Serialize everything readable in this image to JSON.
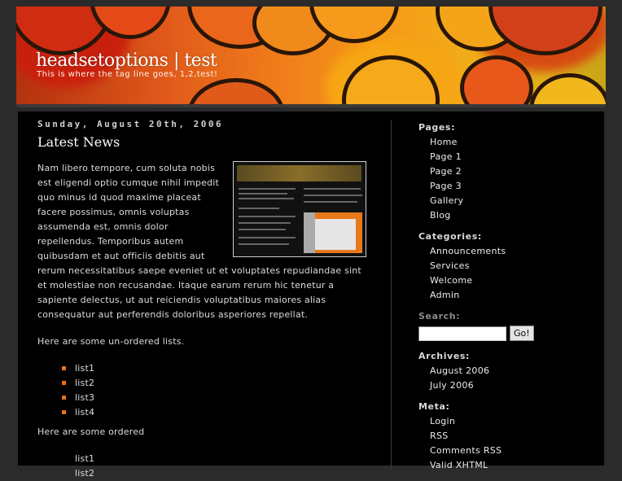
{
  "header": {
    "site_title": "headsetoptions | test",
    "tagline": "This is where the tag line goes, 1,2,test!"
  },
  "post": {
    "date": "Sunday, August 20th, 2006",
    "title": "Latest News",
    "paragraph1": "Nam libero tempore, cum soluta nobis est eligendi optio cumque nihil impedit quo minus id quod maxime placeat facere possimus, omnis voluptas assumenda est, omnis dolor repellendus. Temporibus autem quibusdam et aut officiis debitis aut rerum necessitatibus saepe eveniet ut et voluptates repudiandae sint et molestiae non recusandae. Itaque earum rerum hic tenetur a sapiente delectus, ut aut reiciendis voluptatibus maiores alias consequatur aut perferendis doloribus asperiores repellat.",
    "paragraph2": "Here are some un-ordered lists.",
    "unordered_list": [
      "list1",
      "list2",
      "list3",
      "list4"
    ],
    "paragraph3": "Here are some ordered",
    "ordered_list": [
      "list1",
      "list2"
    ]
  },
  "sidebar": {
    "pages_heading": "Pages:",
    "pages": [
      "Home",
      "Page 1",
      "Page 2",
      "Page 3",
      "Gallery",
      "Blog"
    ],
    "categories_heading": "Categories:",
    "categories": [
      "Announcements",
      "Services",
      "Welcome",
      "Admin"
    ],
    "search_heading": "Search:",
    "search_value": "",
    "search_button": "Go!",
    "archives_heading": "Archives:",
    "archives": [
      "August 2006",
      "July 2006"
    ],
    "meta_heading": "Meta:",
    "meta": [
      "Login",
      "RSS",
      "Comments RSS",
      "Valid XHTML"
    ]
  },
  "colors": {
    "page_bg": "#2b2b2b",
    "content_bg": "#000000",
    "bullet": "#e8701a",
    "text": "#d8d8d8"
  }
}
